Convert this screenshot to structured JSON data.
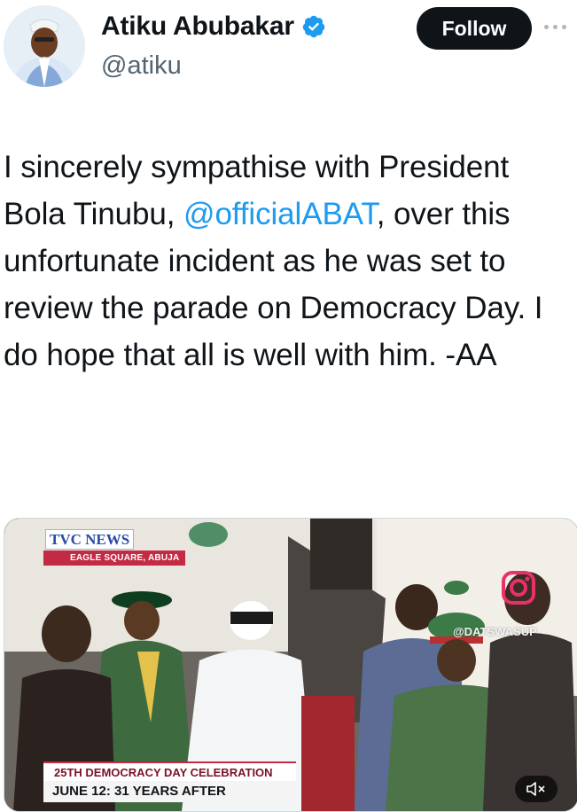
{
  "author": {
    "name": "Atiku Abubakar",
    "handle": "@atiku",
    "verified": true,
    "avatar_icon": "avatar-photo"
  },
  "actions": {
    "follow_label": "Follow",
    "more_icon": "more-options-icon"
  },
  "tweet": {
    "text_before": "I sincerely sympathise with President Bola Tinubu, ",
    "mention": "@officialABAT",
    "text_after": ", over this unfortunate incident as he was set to review the parade on Democracy Day. I do hope that all is well with him. -AA"
  },
  "media": {
    "type": "video",
    "channel_logo": "TVC NEWS",
    "location": "EAGLE SQUARE, ABUJA",
    "watermark": "@DATSWASUP",
    "lower_third_top": "25TH DEMOCRACY DAY CELEBRATION",
    "lower_third_bottom": "JUNE 12: 31 YEARS AFTER",
    "mute_icon": "speaker-muted-icon"
  },
  "colors": {
    "accent": "#1d9bf0",
    "follow_bg": "#0f1419",
    "text": "#0f1419",
    "muted": "#536471",
    "tvc_red": "#c32a44"
  }
}
